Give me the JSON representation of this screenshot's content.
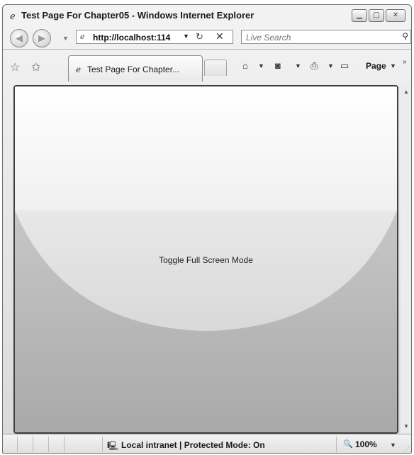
{
  "window": {
    "title": "Test Page For Chapter05 - Windows Internet Explorer",
    "title_icon": "ie-icon",
    "controls": {
      "minimize": "minimize-icon",
      "maximize": "maximize-icon",
      "close": "close-icon"
    }
  },
  "address_bar": {
    "back_icon": "back-arrow-icon",
    "forward_icon": "forward-arrow-icon",
    "url": "http://localhost:114",
    "refresh_icon": "refresh-icon",
    "stop_icon": "stop-icon",
    "search_placeholder": "Live Search"
  },
  "command_bar": {
    "tab_label": "Test Page For Chapter...",
    "page_menu_label": "Page",
    "icons": [
      "favorites-star-icon",
      "add-favorites-icon",
      "home-icon",
      "feeds-icon",
      "print-icon",
      "page-icon"
    ]
  },
  "content": {
    "button_text": "Toggle Full Screen Mode",
    "colors": {
      "top": "#ffffff",
      "bottom": "#b5b5b5"
    }
  },
  "status_bar": {
    "zone_text": "Local intranet | Protected Mode: On",
    "zoom_text": "100%"
  }
}
